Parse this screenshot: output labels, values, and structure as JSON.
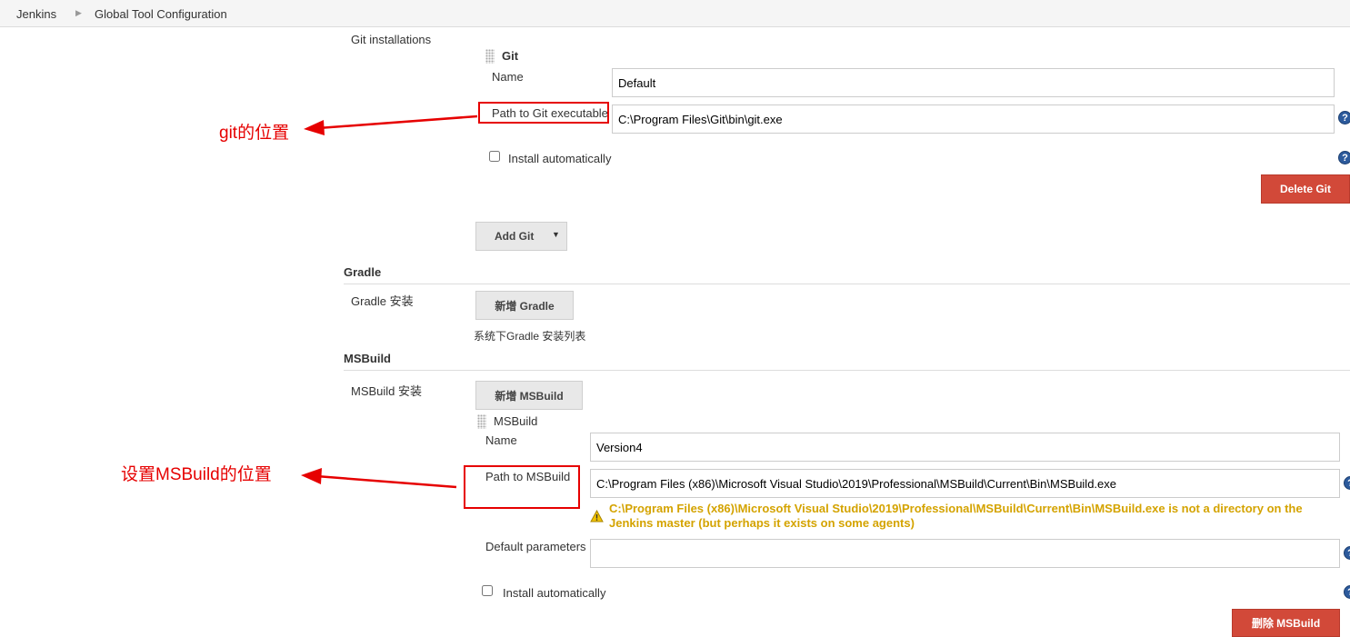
{
  "breadcrumb": {
    "home": "Jenkins",
    "current": "Global Tool Configuration"
  },
  "git": {
    "section_label": "Git installations",
    "item_title": "Git",
    "name_label": "Name",
    "name_value": "Default",
    "path_label": "Path to Git executable",
    "path_value": "C:\\Program Files\\Git\\bin\\git.exe",
    "install_auto_label": "Install automatically",
    "delete_label": "Delete Git",
    "add_label": "Add Git"
  },
  "gradle": {
    "section_title": "Gradle",
    "install_label": "Gradle 安装",
    "add_label": "新增 Gradle",
    "list_note": "系统下Gradle 安装列表"
  },
  "msbuild": {
    "section_title": "MSBuild",
    "install_label": "MSBuild 安装",
    "add_label": "新增 MSBuild",
    "item_title": "MSBuild",
    "name_label": "Name",
    "name_value": "Version4",
    "path_label": "Path to MSBuild",
    "path_value": "C:\\Program Files (x86)\\Microsoft Visual Studio\\2019\\Professional\\MSBuild\\Current\\Bin\\MSBuild.exe",
    "warning_line1": "C:\\Program Files (x86)\\Microsoft Visual Studio\\2019\\Professional\\MSBuild\\Current\\Bin\\MSBuild.exe is not a directory on the",
    "warning_line2": "Jenkins master (but perhaps it exists on some agents)",
    "default_params_label": "Default parameters",
    "default_params_value": "",
    "install_auto_label": "Install automatically",
    "delete_label": "删除 MSBuild"
  },
  "annotations": {
    "git_note": "git的位置",
    "msbuild_note": "设置MSBuild的位置"
  },
  "help_symbol": "?",
  "icons": {
    "help": "help-icon",
    "grip": "drag-handle-icon",
    "dropdown": "caret-down-icon",
    "warning": "warning-icon",
    "breadcrumb_sep": "chevron-right-icon",
    "arrow": "arrow-left-icon"
  },
  "colors": {
    "danger": "#d24939",
    "warning": "#d4a300",
    "annotation": "#e60000",
    "help": "#2c5a9c"
  }
}
